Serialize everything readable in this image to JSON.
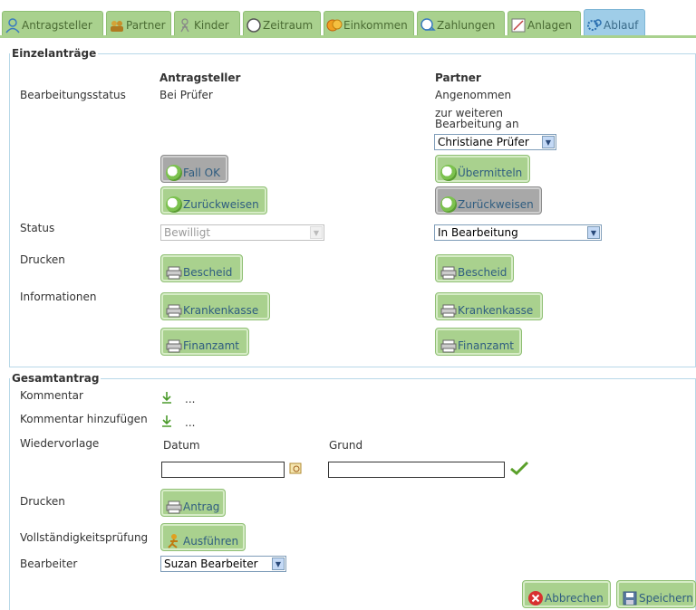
{
  "tabs": [
    {
      "label": "Antragsteller",
      "icon": "person-icon"
    },
    {
      "label": "Partner",
      "icon": "people-icon"
    },
    {
      "label": "Kinder",
      "icon": "child-icon"
    },
    {
      "label": "Zeitraum",
      "icon": "clock-icon"
    },
    {
      "label": "Einkommen",
      "icon": "coins-icon"
    },
    {
      "label": "Zahlungen",
      "icon": "payment-icon"
    },
    {
      "label": "Anlagen",
      "icon": "document-icon"
    },
    {
      "label": "Ablauf",
      "icon": "workflow-icon"
    }
  ],
  "active_tab": "Ablauf",
  "einzel": {
    "legend": "Einzelanträge",
    "col_antragsteller": "Antragsteller",
    "col_partner": "Partner",
    "bearbeitungsstatus_label": "Bearbeitungsstatus",
    "antragsteller_status": "Bei Prüfer",
    "partner_status": "Angenommen",
    "partner_weiter_line1": "zur weiteren",
    "partner_weiter_line2": "Bearbeitung an",
    "partner_bearbeiter_select": "Christiane Prüfer",
    "btn_fall_ok": "Fall OK",
    "btn_uebermitteln": "Übermitteln",
    "btn_zurueckweisen": "Zurückweisen",
    "status_label": "Status",
    "antragsteller_status_select": "Bewilligt",
    "partner_status_select": "In Bearbeitung",
    "drucken_label": "Drucken",
    "btn_bescheid": "Bescheid",
    "informationen_label": "Informationen",
    "btn_krankenkasse": "Krankenkasse",
    "btn_finanzamt": "Finanzamt"
  },
  "gesamt": {
    "legend": "Gesamtantrag",
    "kommentar_label": "Kommentar",
    "kommentar_hinzufuegen_label": "Kommentar hinzufügen",
    "ellipsis": "...",
    "wiedervorlage_label": "Wiedervorlage",
    "datum_label": "Datum",
    "grund_label": "Grund",
    "datum_value": "",
    "grund_value": "",
    "drucken_label": "Drucken",
    "btn_antrag": "Antrag",
    "vollstaendigkeit_label": "Vollständigkeitsprüfung",
    "btn_ausfuehren": "Ausführen",
    "bearbeiter_label": "Bearbeiter",
    "bearbeiter_select": "Suzan Bearbeiter"
  },
  "footer": {
    "btn_abbrechen": "Abbrechen",
    "btn_speichern": "Speichern"
  },
  "colors": {
    "tab_green": "#a9d18e",
    "tab_active": "#9fcde8",
    "button_green": "#a9d18e",
    "button_gray": "#a8a8a8"
  }
}
